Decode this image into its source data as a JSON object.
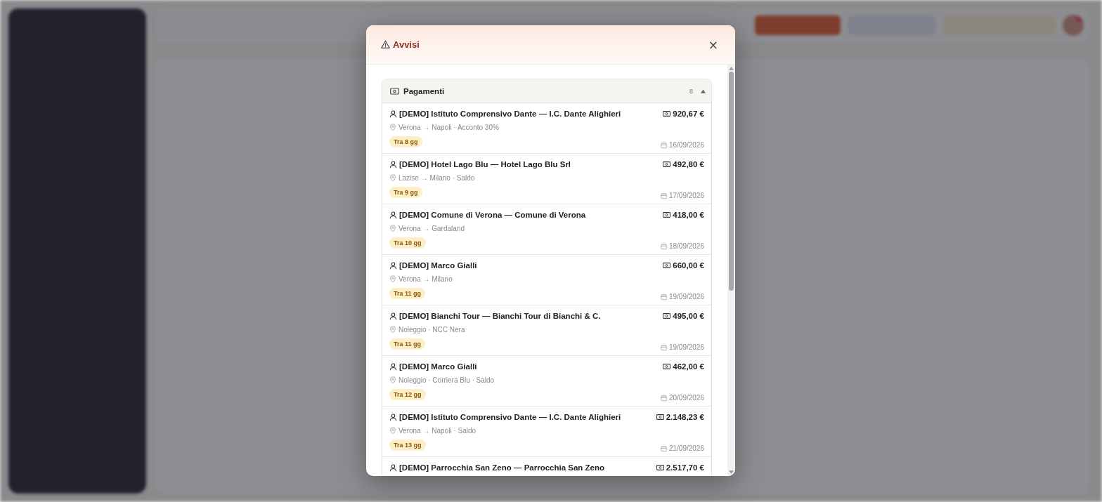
{
  "modal": {
    "title": "Avvisi",
    "close": "×",
    "sections": [
      {
        "title": "Pagamenti",
        "count": "8",
        "expanded": true,
        "items": [
          {
            "client": "[DEMO] Istituto Comprensivo Dante — I.C. Dante Alighieri",
            "amount": "920,67 €",
            "route": "Verona → Napoli · Acconto 30%",
            "badge": "Tra 8 gg",
            "date": "16/09/2026"
          },
          {
            "client": "[DEMO] Hotel Lago Blu — Hotel Lago Blu Srl",
            "amount": "492,80 €",
            "route": "Lazise → Milano · Saldo",
            "badge": "Tra 9 gg",
            "date": "17/09/2026"
          },
          {
            "client": "[DEMO] Comune di Verona — Comune di Verona",
            "amount": "418,00 €",
            "route": "Verona → Gardaland",
            "badge": "Tra 10 gg",
            "date": "18/09/2026"
          },
          {
            "client": "[DEMO] Marco Gialli",
            "amount": "660,00 €",
            "route": "Verona → Milano",
            "badge": "Tra 11 gg",
            "date": "19/09/2026"
          },
          {
            "client": "[DEMO] Bianchi Tour — Bianchi Tour di Bianchi & C.",
            "amount": "495,00 €",
            "route": "Noleggio · NCC Nera",
            "badge": "Tra 11 gg",
            "date": "19/09/2026"
          },
          {
            "client": "[DEMO] Marco Gialli",
            "amount": "462,00 €",
            "route": "Noleggio · Corriera Blu · Saldo",
            "badge": "Tra 12 gg",
            "date": "20/09/2026"
          },
          {
            "client": "[DEMO] Istituto Comprensivo Dante — I.C. Dante Alighieri",
            "amount": "2.148,23 €",
            "route": "Verona → Napoli · Saldo",
            "badge": "Tra 13 gg",
            "date": "21/09/2026"
          },
          {
            "client": "[DEMO] Parrocchia San Zeno — Parrocchia San Zeno",
            "amount": "2.517,70 €"
          }
        ]
      }
    ]
  }
}
